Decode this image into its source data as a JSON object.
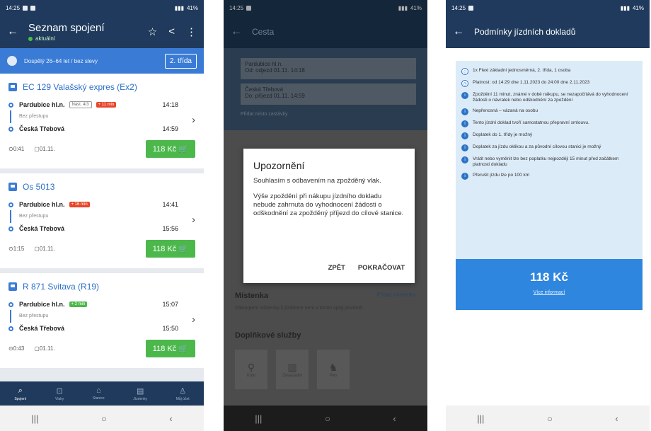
{
  "colors": {
    "app_bar": "#1f3a5c",
    "accent_blue": "#3a7bd5",
    "price_green": "#4cb84c",
    "delay_red": "#e8452b",
    "info_panel": "#dcebf8",
    "price_box": "#2e86de"
  },
  "phone1": {
    "status": {
      "time": "14:25",
      "right": "41%"
    },
    "title": "Seznam spojení",
    "subtitle": "aktuální",
    "filter_text": "Dospělý 26–64 let / bez slevy",
    "class_button": "2. třída",
    "connections": [
      {
        "train": "EC 129 Valašský expres (Ex2)",
        "from": "Pardubice hl.n.",
        "platform": "Nást. 4/3",
        "delay": "+ 11 min",
        "dep": "14:18",
        "transfer": "Bez přestupu",
        "to": "Česká Třebová",
        "arr": "14:59",
        "duration": "0:41",
        "date": "01.11.",
        "price": "118 Kč"
      },
      {
        "train": "Os 5013",
        "from": "Pardubice hl.n.",
        "delay": "+ 16 min",
        "dep": "14:41",
        "transfer": "Bez přestupu",
        "to": "Česká Třebová",
        "arr": "15:56",
        "duration": "1:15",
        "date": "01.11.",
        "price": "118 Kč"
      },
      {
        "train": "R 871 Svitava (R19)",
        "from": "Pardubice hl.n.",
        "delay": "+ 2 min",
        "dep": "15:07",
        "transfer": "Bez přestupu",
        "to": "Česká Třebová",
        "arr": "15:50",
        "duration": "0:43",
        "date": "01.11.",
        "price": "118 Kč"
      }
    ],
    "bottom_nav": [
      "Spojení",
      "Vlaky",
      "Stanice",
      "Jízdenky",
      "Můj účet"
    ]
  },
  "phone2": {
    "status": {
      "time": "14:25",
      "right": "41%"
    },
    "title": "Cesta",
    "from_field": "Pardubice hl.n.",
    "from_sub": "Od: odjezd 01.11. 14:18",
    "to_field": "Česká Třebová",
    "to_sub": "Do: příjezd 01.11. 14:59",
    "add_via": "Přidat místo zastávky",
    "section_mistenka": "Místenka",
    "mistenka_link": "Přidat místenku",
    "mistenka_note": "Zakoupení místenky k jízdence není v tomto spoji povinné.",
    "section_extras": "Doplňkové služby",
    "extras": [
      "Kolo",
      "Zavazadlo",
      "Pes"
    ],
    "dialog": {
      "title": "Upozornění",
      "text1": "Souhlasím s odbavením na zpožděný vlak.",
      "text2": "Výše zpoždění při nákupu jízdního dokladu nebude zahrnuta do vyhodnocení žádosti o odškodnění za zpožděný příjezd do cílové stanice.",
      "btn_back": "ZPĚT",
      "btn_continue": "POKRAČOVAT"
    }
  },
  "phone3": {
    "status": {
      "time": "14:25",
      "right": "41%"
    },
    "title": "Podmínky jízdních dokladů",
    "conditions": [
      "1x Flexi základní jednosměrná, 2. třída, 1 osoba",
      "Platnost: od 14:29 dne 1.11.2023 do 24:00 dne 2.11.2023",
      "Zpoždění 11 minut, známé v době nákupu, se nezapočítává do vyhodnocení žádosti o návratek nebo odškodnění za zpoždění",
      "Nepřenosná – vázaná na osobu",
      "Tento jízdní doklad tvoří samostatnou přepravní smlouvu.",
      "Doplatek do 1. třídy je možný",
      "Doplatek za jízdu oklikou a za původní cílovou stanici je možný",
      "Vrátit nebo vyměnit lze bez poplatku nejpozději 15 minut před začátkem platnosti dokladu",
      "Přerušit jízdu lze po 100 km"
    ],
    "price": "118 Kč",
    "more_info": "Více informací"
  }
}
